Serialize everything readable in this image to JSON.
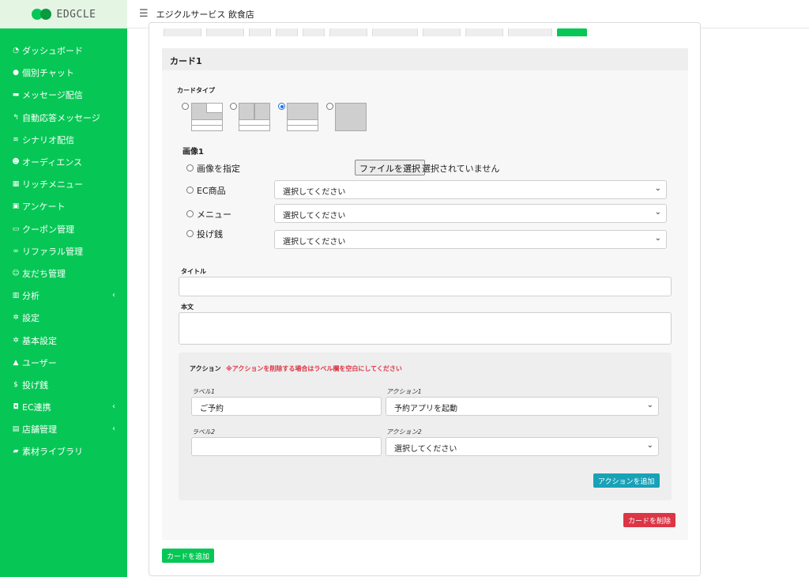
{
  "brand": {
    "name": "EDGCLE"
  },
  "header": {
    "menu_icon": "menu-icon",
    "store_name": "エジクルサービス 飲食店"
  },
  "sidebar": {
    "items": [
      {
        "label": "ダッシュボード",
        "icon": "dashboard-icon"
      },
      {
        "label": "個別チャット",
        "icon": "chat-icon"
      },
      {
        "label": "メッセージ配信",
        "icon": "message-icon"
      },
      {
        "label": "自動応答メッセージ",
        "icon": "reply-icon"
      },
      {
        "label": "シナリオ配信",
        "icon": "layers-icon"
      },
      {
        "label": "オーディエンス",
        "icon": "users-icon"
      },
      {
        "label": "リッチメニュー",
        "icon": "grid-icon"
      },
      {
        "label": "アンケート",
        "icon": "poll-icon"
      },
      {
        "label": "クーポン管理",
        "icon": "ticket-icon"
      },
      {
        "label": "リファラル管理",
        "icon": "link-icon"
      },
      {
        "label": "友だち管理",
        "icon": "friends-icon"
      },
      {
        "label": "分析",
        "icon": "chart-icon",
        "chevron": "‹"
      },
      {
        "label": "設定",
        "icon": "gear-icon"
      },
      {
        "label": "基本設定",
        "icon": "gear-icon"
      },
      {
        "label": "ユーザー",
        "icon": "user-icon"
      },
      {
        "label": "投げ銭",
        "icon": "dollar-icon"
      },
      {
        "label": "EC連携",
        "icon": "bag-icon",
        "chevron": "‹"
      },
      {
        "label": "店舗管理",
        "icon": "store-icon",
        "chevron": "‹"
      },
      {
        "label": "素材ライブラリ",
        "icon": "folder-icon"
      }
    ]
  },
  "card": {
    "title": "カード1",
    "card_type_label": "カードタイプ",
    "card_type_options": [
      "type-1",
      "type-2",
      "type-3",
      "type-4"
    ],
    "card_type_selected_index": 2,
    "image_label": "画像1",
    "image_options": [
      {
        "label": "画像を指定"
      },
      {
        "label": "EC商品",
        "select": "選択してください"
      },
      {
        "label": "メニュー",
        "select": "選択してください"
      },
      {
        "label": "投げ銭",
        "select": "選択してください"
      }
    ],
    "file_button": "ファイルを選択",
    "file_status": "選択されていません",
    "title_label": "タイトル",
    "title_value": "",
    "body_label": "本文",
    "body_value": "",
    "action": {
      "label": "アクション",
      "note": "※アクションを削除する場合はラベル欄を空白にしてください",
      "rows": [
        {
          "label_caption": "ラベル1",
          "label_value": "ご予約",
          "action_caption": "アクション1",
          "action_value": "予約アプリを起動"
        },
        {
          "label_caption": "ラベル2",
          "label_value": "",
          "action_caption": "アクション2",
          "action_value": "選択してください"
        }
      ],
      "add_button": "アクションを追加"
    },
    "delete_button": "カードを削除"
  },
  "add_card_button": "カードを追加",
  "colors": {
    "brand": "#06c755",
    "danger": "#dc3545",
    "info": "#17a2b8",
    "note": "#dc3545"
  }
}
